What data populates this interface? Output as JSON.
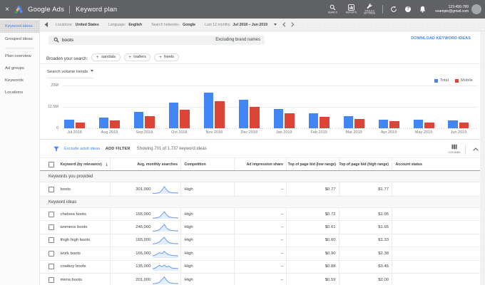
{
  "colors": {
    "accent_blue": "#4285f4",
    "bar_blue": "#4285f4",
    "bar_red": "#db4437",
    "topbar_gray": "#606164",
    "spark_line": "#5b8ff0",
    "spark_fill": "#e4edfb"
  },
  "topbar": {
    "close_label": "×",
    "product": "Google Ads",
    "page": "Keyword plan",
    "nav": [
      {
        "icon": "search-icon",
        "label": "SEARCH"
      },
      {
        "icon": "reports-icon",
        "label": "REPORTS"
      },
      {
        "icon": "tools-icon",
        "label": "TOOLS &\nSETTINGS"
      }
    ],
    "account_id": "123-456-789",
    "account_email": "example@gmail.com"
  },
  "contextbar": {
    "filters": [
      {
        "label": "Locations:",
        "value": "United States"
      },
      {
        "label": "Language:",
        "value": "English"
      },
      {
        "label": "Search networks:",
        "value": "Google"
      }
    ],
    "date_label": "Last 12 months",
    "date_range": "Jul 2018 – Jun 2019",
    "prev": "❮",
    "next": "❯"
  },
  "sidebar": {
    "items": [
      {
        "label": "Keyword ideas",
        "selected": true
      },
      {
        "label": "Grouped ideas"
      },
      {
        "divider": true
      },
      {
        "label": "Plan overview"
      },
      {
        "label": "Ad groups"
      },
      {
        "label": "Keywords"
      },
      {
        "label": "Locations"
      }
    ]
  },
  "search": {
    "query": "boots",
    "note": "Excluding brand names",
    "download_label": "DOWNLOAD KEYWORD IDEAS"
  },
  "broaden": {
    "label": "Broaden your search:",
    "chips": [
      "sandals",
      "loafers",
      "heels"
    ]
  },
  "chart_data": {
    "type": "bar",
    "title": "Search volume trends",
    "legend_position": "top-right",
    "categories": [
      "Jul 2018",
      "Aug 2018",
      "Sep 2018",
      "Oct 2018",
      "Nov 2018",
      "Dec 2018",
      "Jan 2019",
      "Feb 2019",
      "Mar 2019",
      "Apr 2019",
      "May 2019",
      "Jun 2019"
    ],
    "series": [
      {
        "name": "Total",
        "color": "#4285f4",
        "values": [
          5.0,
          6.2,
          9.7,
          15.1,
          20.9,
          16.8,
          11.1,
          8.8,
          7.3,
          5.2,
          5.0,
          4.4
        ]
      },
      {
        "name": "Mobile",
        "color": "#db4437",
        "values": [
          3.5,
          4.7,
          7.2,
          11.0,
          16.0,
          12.6,
          8.6,
          6.5,
          5.5,
          4.0,
          3.5,
          3.3
        ]
      }
    ],
    "unit": "M",
    "ylim": [
      0,
      25
    ],
    "yticks": [
      {
        "v": 25,
        "label": "25M"
      },
      {
        "v": 12.5,
        "label": "12.5M"
      },
      {
        "v": 0,
        "label": "0"
      }
    ]
  },
  "filterbar": {
    "exclude": "Exclude adult ideas",
    "add_filter": "ADD FILTER",
    "showing": "Showing 701 of 1,737 keyword ideas",
    "columns_label": "COLUMNS"
  },
  "table": {
    "columns": [
      {
        "key": "keyword",
        "label": "Keyword (by relevance)",
        "sort": "↓"
      },
      {
        "key": "searches",
        "label": "Avg. monthly searches",
        "align": "right"
      },
      {
        "key": "competition",
        "label": "Competition"
      },
      {
        "key": "impr",
        "label": "Ad impression share",
        "align": "right"
      },
      {
        "key": "low",
        "label": "Top of page bid (low range)",
        "align": "right"
      },
      {
        "key": "high",
        "label": "Top of page bid (high range)",
        "align": "right"
      },
      {
        "key": "status",
        "label": "Account status"
      }
    ],
    "sections": [
      {
        "title": "Keywords you provided",
        "rows": [
          {
            "keyword": "boots",
            "searches": "301,000",
            "competition": "High",
            "impr": "–",
            "low": "$0.77",
            "high": "$1.77",
            "status": "",
            "spark": [
              0.6,
              0.6,
              0.9,
              1.6,
              4.2,
              8.5,
              4.6,
              2.0,
              1.5,
              1.2,
              1.1,
              1.0
            ]
          }
        ]
      },
      {
        "title": "Keyword ideas",
        "rows": [
          {
            "keyword": "chelsea boots",
            "searches": "165,000",
            "competition": "High",
            "impr": "–",
            "low": "$0.72",
            "high": "$1.95",
            "status": "",
            "spark": [
              0.7,
              0.8,
              1.2,
              2.2,
              5.0,
              8.2,
              4.4,
              2.2,
              1.6,
              1.2,
              1.0,
              0.9
            ]
          },
          {
            "keyword": "womens boots",
            "searches": "246,000",
            "competition": "High",
            "impr": "–",
            "low": "$0.61",
            "high": "$1.65",
            "status": "",
            "spark": [
              0.6,
              0.7,
              1.1,
              2.4,
              5.4,
              8.4,
              4.2,
              2.0,
              1.4,
              1.1,
              0.9,
              0.8
            ]
          },
          {
            "keyword": "thigh high boots",
            "searches": "165,000",
            "competition": "High",
            "impr": "–",
            "low": "$0.60",
            "high": "$1.33",
            "status": "",
            "spark": [
              0.7,
              0.9,
              1.6,
              3.0,
              6.0,
              8.3,
              4.4,
              2.2,
              1.5,
              1.1,
              0.9,
              0.8
            ]
          },
          {
            "keyword": "work boots",
            "searches": "165,000",
            "competition": "High",
            "impr": "–",
            "low": "$0.90",
            "high": "$2.38",
            "status": "",
            "spark": [
              2.6,
              3.2,
              4.6,
              6.2,
              5.2,
              7.6,
              5.2,
              3.6,
              3.2,
              2.8,
              2.6,
              2.6
            ]
          },
          {
            "keyword": "cowboy boots",
            "searches": "135,000",
            "competition": "High",
            "impr": "–",
            "low": "$0.88",
            "high": "$3.45",
            "status": "",
            "spark": [
              2.4,
              3.0,
              4.8,
              6.4,
              4.6,
              6.8,
              4.4,
              5.6,
              3.4,
              2.8,
              2.8,
              2.6
            ]
          },
          {
            "keyword": "mens boots",
            "searches": "201,000",
            "competition": "High",
            "impr": "–",
            "low": "$0.59",
            "high": "$2.00",
            "status": "",
            "spark": [
              0.7,
              0.9,
              1.4,
              2.6,
              5.6,
              8.6,
              4.6,
              2.2,
              1.5,
              1.1,
              0.9,
              0.8
            ]
          }
        ]
      }
    ]
  }
}
